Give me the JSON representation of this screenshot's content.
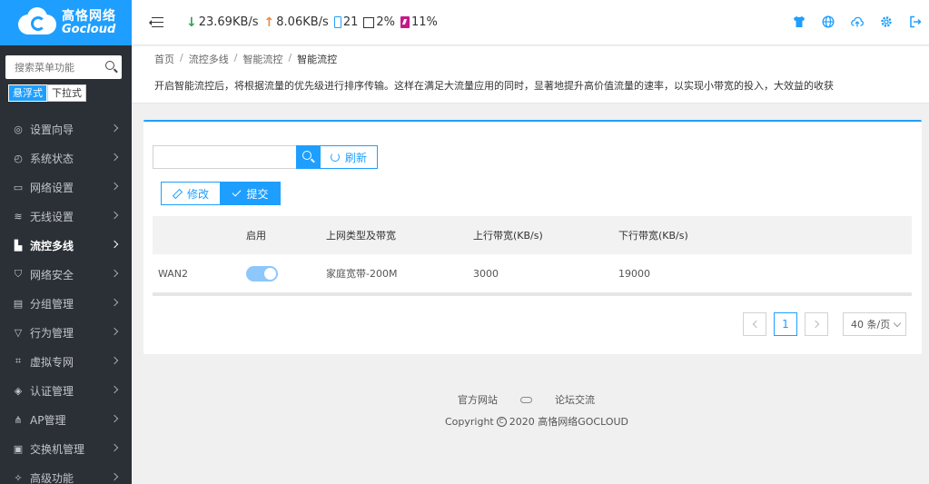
{
  "brand": {
    "name_cn": "高恪网络",
    "name_en": "Gocloud"
  },
  "sidebar": {
    "search_placeholder": "搜索菜单功能",
    "modes": [
      "悬浮式",
      "下拉式"
    ],
    "items": [
      {
        "label": "设置向导",
        "icon": "compass-icon",
        "glyph": "◎"
      },
      {
        "label": "系统状态",
        "icon": "gauge-icon",
        "glyph": "◴"
      },
      {
        "label": "网络设置",
        "icon": "monitor-icon",
        "glyph": "▭"
      },
      {
        "label": "无线设置",
        "icon": "wifi-icon",
        "glyph": "≋"
      },
      {
        "label": "流控多线",
        "icon": "bars-icon",
        "glyph": "▙"
      },
      {
        "label": "网络安全",
        "icon": "shield-icon",
        "glyph": "⛉"
      },
      {
        "label": "分组管理",
        "icon": "group-icon",
        "glyph": "▤"
      },
      {
        "label": "行为管理",
        "icon": "filter-icon",
        "glyph": "▽"
      },
      {
        "label": "虚拟专网",
        "icon": "vpn-icon",
        "glyph": "⌗"
      },
      {
        "label": "认证管理",
        "icon": "verified-icon",
        "glyph": "◈"
      },
      {
        "label": "AP管理",
        "icon": "network-icon",
        "glyph": "⋔"
      },
      {
        "label": "交换机管理",
        "icon": "switch-icon",
        "glyph": "▣"
      },
      {
        "label": "高级功能",
        "icon": "pin-icon",
        "glyph": "✧"
      }
    ]
  },
  "header": {
    "download": "23.69KB/s",
    "upload": "8.06KB/s",
    "devices": "21",
    "cpu": "2%",
    "battery": "11%"
  },
  "breadcrumb": [
    "首页",
    "流控多线",
    "智能流控",
    "智能流控"
  ],
  "description": "开启智能流控后，将根据流量的优先级进行排序传输。这样在满足大流量应用的同时，显著地提升高价值流量的速率，以实现小带宽的投入，大效益的收获",
  "toolbar": {
    "refresh_label": "刷新",
    "edit_label": "修改",
    "submit_label": "提交"
  },
  "table": {
    "headers": [
      "",
      "启用",
      "上网类型及带宽",
      "上行带宽(KB/s)",
      "下行带宽(KB/s)"
    ],
    "rows": [
      {
        "name": "WAN2",
        "enabled": true,
        "type": "家庭宽带-200M",
        "up": "3000",
        "down": "19000"
      }
    ]
  },
  "pagination": {
    "current": "1",
    "page_size": "40 条/页"
  },
  "footer": {
    "link1": "官方网站",
    "link2": "论坛交流",
    "copyright": "Copyright",
    "year_brand": "2020 高恪网络GOCLOUD"
  },
  "colors": {
    "accent": "#1e9fff",
    "sidebar": "#2b3036",
    "toggle_on": "#8dc7fb"
  }
}
